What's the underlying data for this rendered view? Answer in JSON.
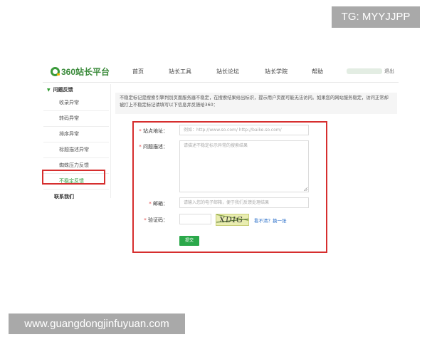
{
  "watermarks": {
    "top": "TG: MYYJJPP",
    "bottom": "www.guangdongjinfuyuan.com"
  },
  "header": {
    "logo_text": "360站长平台",
    "nav": [
      "首页",
      "站长工具",
      "站长论坛",
      "站长学院",
      "帮助"
    ],
    "logout": "退出"
  },
  "sidebar": {
    "section_title": "问题反馈",
    "items": [
      "收录异常",
      "转码异常",
      "排序异常",
      "标题描述异常",
      "蜘蛛压力反馈",
      "不稳定反馈"
    ],
    "active_index": 5,
    "contact": "联系我们"
  },
  "notice": "不稳定标记是搜索引擎判别页面服务器不稳定，在搜索结果给出标识，提示用户页面可能无法访问。如果您的网站服务稳定，访问正常却被打上不稳定标记请填写以下信息并反馈给360：",
  "form": {
    "site_label": "站点地址：",
    "site_placeholder": "例如：http://www.so.com/ http://baike.so.com/",
    "desc_label": "问题描述：",
    "desc_placeholder": "请描述不稳定标示异常的搜索结果",
    "email_label": "邮箱：",
    "email_placeholder": "请输入您的电子邮箱，便于我们反馈处理结果",
    "captcha_label": "验证码：",
    "captcha_text": "XDIG",
    "captcha_refresh": "看不清？换一张",
    "submit": "提交"
  },
  "colors": {
    "accent_green": "#2aa84a",
    "highlight_red": "#d62e2e",
    "link_blue": "#2a6fc9"
  }
}
